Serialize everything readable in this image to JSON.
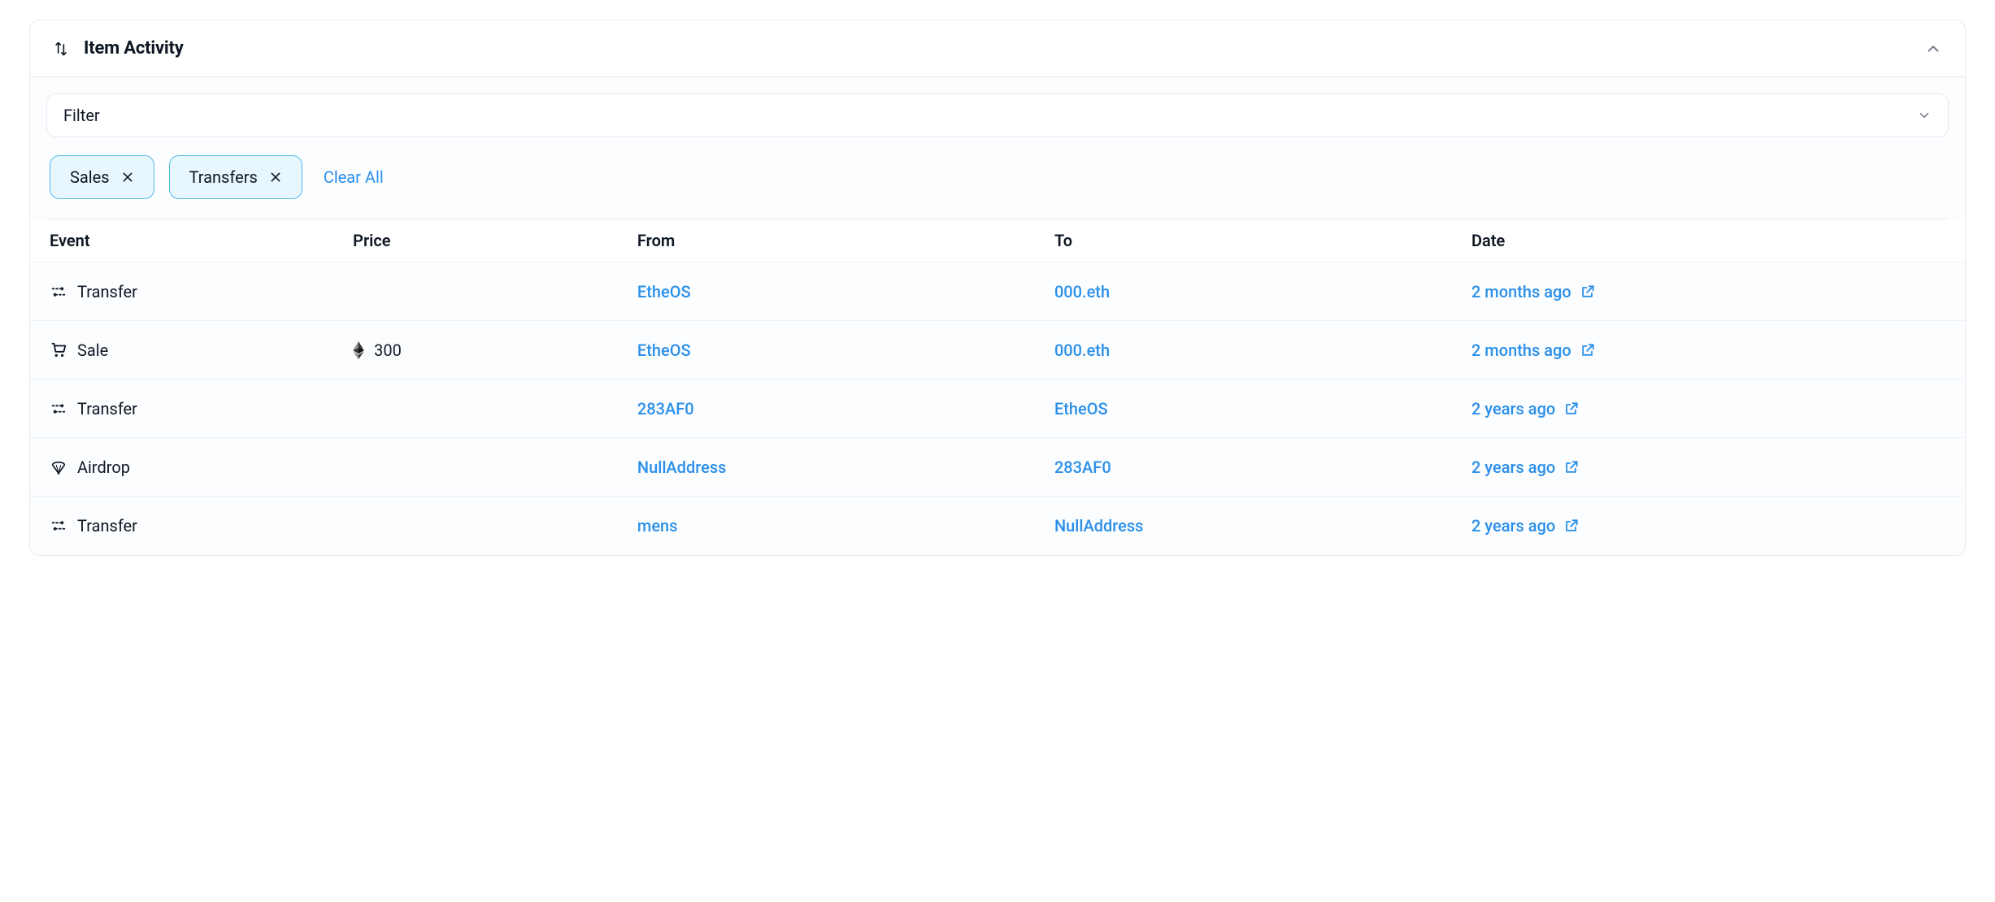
{
  "header": {
    "title": "Item Activity"
  },
  "filter": {
    "label": "Filter",
    "chips": [
      {
        "label": "Sales"
      },
      {
        "label": "Transfers"
      }
    ],
    "clear_all_label": "Clear All"
  },
  "table": {
    "columns": {
      "event": "Event",
      "price": "Price",
      "from": "From",
      "to": "To",
      "date": "Date"
    },
    "rows": [
      {
        "event_type": "Transfer",
        "price": "",
        "from": "EtheOS",
        "to": "000.eth",
        "date": "2 months ago",
        "has_ext_link": true
      },
      {
        "event_type": "Sale",
        "price": "300",
        "from": "EtheOS",
        "to": "000.eth",
        "date": "2 months ago",
        "has_ext_link": true
      },
      {
        "event_type": "Transfer",
        "price": "",
        "from": "283AF0",
        "to": "EtheOS",
        "date": "2 years ago",
        "has_ext_link": true
      },
      {
        "event_type": "Airdrop",
        "price": "",
        "from": "NullAddress",
        "to": "283AF0",
        "date": "2 years ago",
        "has_ext_link": true
      },
      {
        "event_type": "Transfer",
        "price": "",
        "from": "mens",
        "to": "NullAddress",
        "date": "2 years ago",
        "has_ext_link": true
      }
    ]
  },
  "icons": {
    "transfer": "transfer-icon",
    "sale": "cart-icon",
    "airdrop": "parachute-icon",
    "eth": "ethereum-icon",
    "external": "external-link-icon",
    "chevron_up": "chevron-up-icon",
    "chevron_down": "chevron-down-icon",
    "swap": "swap-vertical-icon",
    "close": "close-icon"
  }
}
